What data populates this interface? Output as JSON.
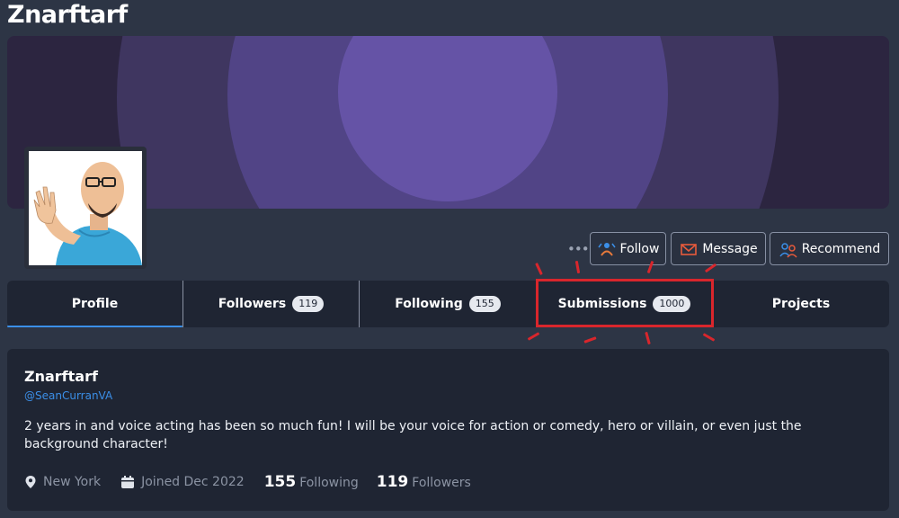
{
  "page": {
    "title": "Znarftarf"
  },
  "actions": {
    "more_label": "•••",
    "follow_label": "Follow",
    "message_label": "Message",
    "recommend_label": "Recommend"
  },
  "tabs": [
    {
      "label": "Profile",
      "badge": ""
    },
    {
      "label": "Followers",
      "badge": "119"
    },
    {
      "label": "Following",
      "badge": "155"
    },
    {
      "label": "Submissions",
      "badge": "1000"
    },
    {
      "label": "Projects",
      "badge": ""
    }
  ],
  "profile": {
    "name": "Znarftarf",
    "handle": "@SeanCurranVA",
    "bio": "2 years in and voice acting has been so much fun! I will be your voice for action or comedy, hero or villain, or even just the background character!",
    "location": "New York",
    "joined": "Joined Dec 2022",
    "following_count": "155",
    "following_label": "Following",
    "followers_count": "119",
    "followers_label": "Followers"
  },
  "colors": {
    "background": "#2d3545",
    "card": "#1f2533",
    "accent": "#3b8fe8",
    "highlight": "#d9262c",
    "banner_center": "#6553a6"
  }
}
